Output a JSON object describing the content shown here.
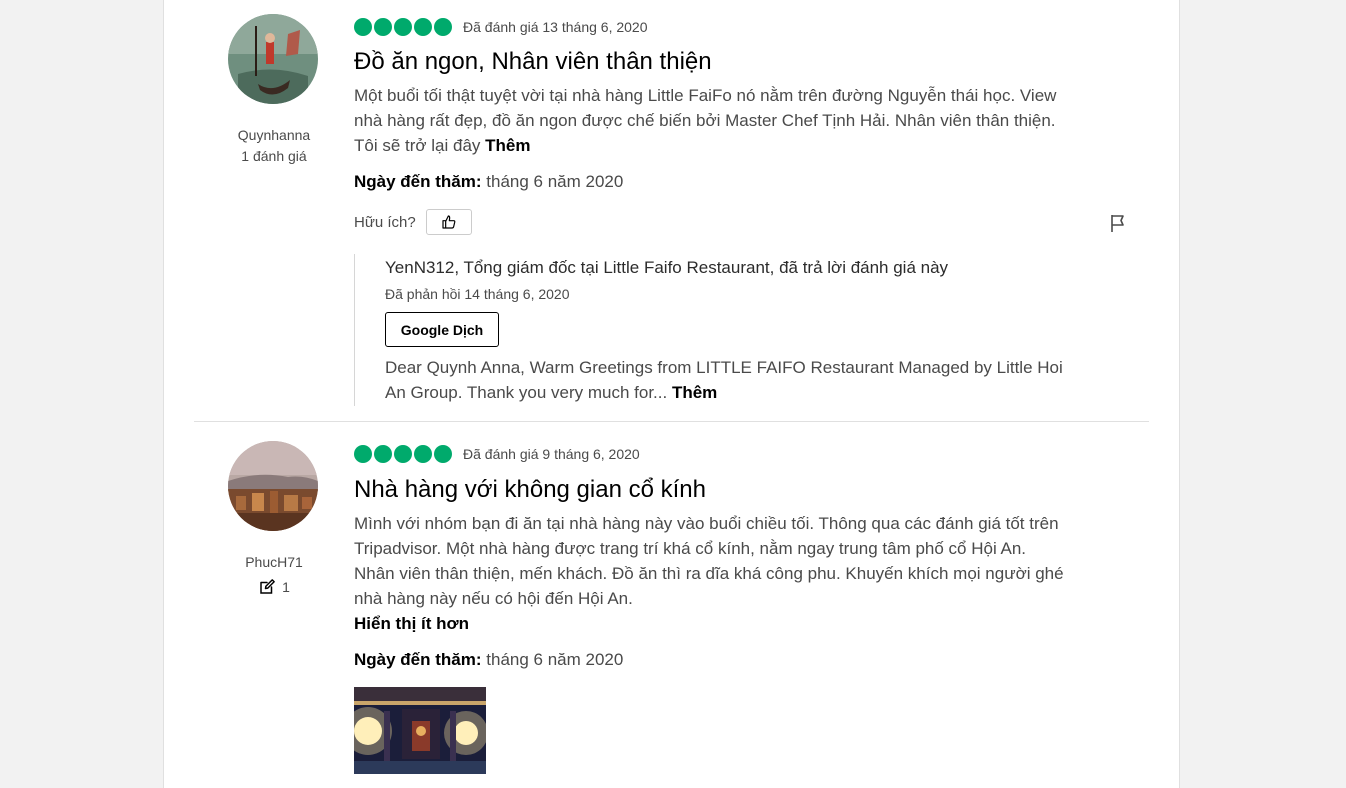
{
  "colors": {
    "rating_bubble": "#00aa6c",
    "text_secondary": "#4a4a4a",
    "page_background": "#f2f2f2"
  },
  "reviews": [
    {
      "username": "Quynhanna",
      "contributions": "1 đánh giá",
      "rating": 5,
      "rated_date": "Đã đánh giá 13 tháng 6, 2020",
      "title": "Đồ ăn ngon, Nhân viên thân thiện",
      "body": "Một buổi tối thật tuyệt vời tại nhà hàng Little FaiFo nó nằm trên đường Nguyễn thái học. View nhà hàng rất đẹp, đồ ăn ngon được chế biến bởi Master Chef Tịnh Hải. Nhân viên thân thiện. Tôi sẽ trở lại đây",
      "more_label": "Thêm",
      "visit_label": "Ngày đến thăm:",
      "visit_date": "tháng 6 năm 2020",
      "helpful_label": "Hữu ích?",
      "like_icon": "thumbs-up-icon",
      "flag_icon": "flag-icon",
      "response": {
        "title": "YenN312, Tổng giám đốc tại Little Faifo Restaurant, đã trả lời đánh giá này",
        "date": "Đã phản hồi 14 tháng 6, 2020",
        "translate_label": "Google Dịch",
        "body": "Dear Quynh Anna, Warm Greetings from LITTLE FAIFO Restaurant Managed by Little Hoi An Group. Thank you very much for...",
        "more_label": "Thêm"
      }
    },
    {
      "username": "PhucH71",
      "contributions_icon": "edit-icon",
      "contributions": "1",
      "rating": 5,
      "rated_date": "Đã đánh giá 9 tháng 6, 2020",
      "title": "Nhà hàng với không gian cổ kính",
      "body": "Mình với nhóm bạn đi ăn tại nhà hàng này vào buổi chiều tối. Thông qua các đánh giá tốt trên Tripadvisor. Một nhà hàng được trang trí khá cổ kính, nằm ngay trung tâm phố cổ Hội An. Nhân viên thân thiện, mến khách. Đồ ăn thì ra dĩa khá công phu. Khuyến khích mọi người ghé nhà hàng này nếu có hội đến Hội An.",
      "less_label": "Hiển thị ít hơn",
      "visit_label": "Ngày đến thăm:",
      "visit_date": "tháng 6 năm 2020"
    }
  ]
}
